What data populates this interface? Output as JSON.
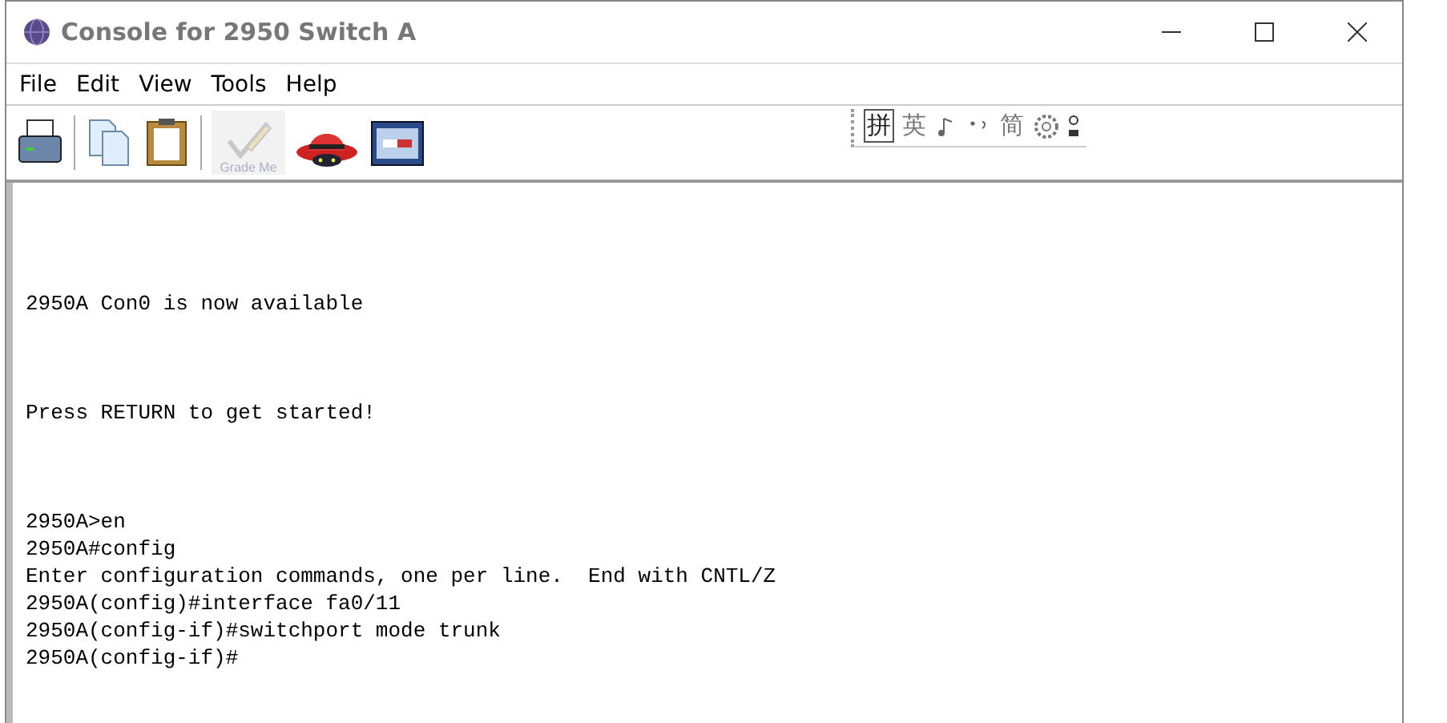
{
  "window": {
    "title": "Console for 2950 Switch A"
  },
  "menu": [
    "File",
    "Edit",
    "View",
    "Tools",
    "Help"
  ],
  "toolbar": [
    {
      "kind": "print"
    },
    {
      "kind": "copy"
    },
    {
      "kind": "paste"
    },
    {
      "kind": "grade",
      "label": "Grade Me",
      "disabled": true
    },
    {
      "kind": "hat"
    },
    {
      "kind": "switch"
    }
  ],
  "ime_bar": {
    "items": [
      "拼",
      "英",
      "简"
    ]
  },
  "console": {
    "blocks": [
      {
        "lines": [
          "2950A Con0 is now available"
        ]
      },
      {
        "lines": [
          "Press RETURN to get started!"
        ]
      },
      {
        "lines": [
          "2950A>en",
          "2950A#config",
          "Enter configuration commands, one per line.  End with CNTL/Z",
          "2950A(config)#interface fa0/11",
          "2950A(config-if)#switchport mode trunk",
          "2950A(config-if)#"
        ]
      }
    ]
  }
}
